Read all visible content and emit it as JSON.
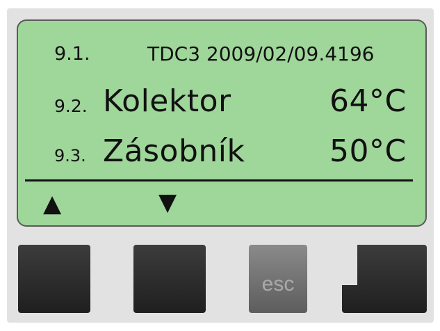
{
  "display": {
    "row1": {
      "number": "9.1.",
      "text": "TDC3 2009/02/09.4196"
    },
    "row2": {
      "number": "9.2.",
      "label": "Kolektor",
      "value": "64°C"
    },
    "row3": {
      "number": "9.3.",
      "label": "Zásobník",
      "value": "50°C"
    },
    "soft_keys": {
      "left": "▲",
      "right": "▼"
    }
  },
  "buttons": {
    "esc_label": "esc"
  },
  "colors": {
    "lcd_background": "#9fd69a",
    "button_dark": "#2a2a2a",
    "esc_button": "#777777"
  }
}
